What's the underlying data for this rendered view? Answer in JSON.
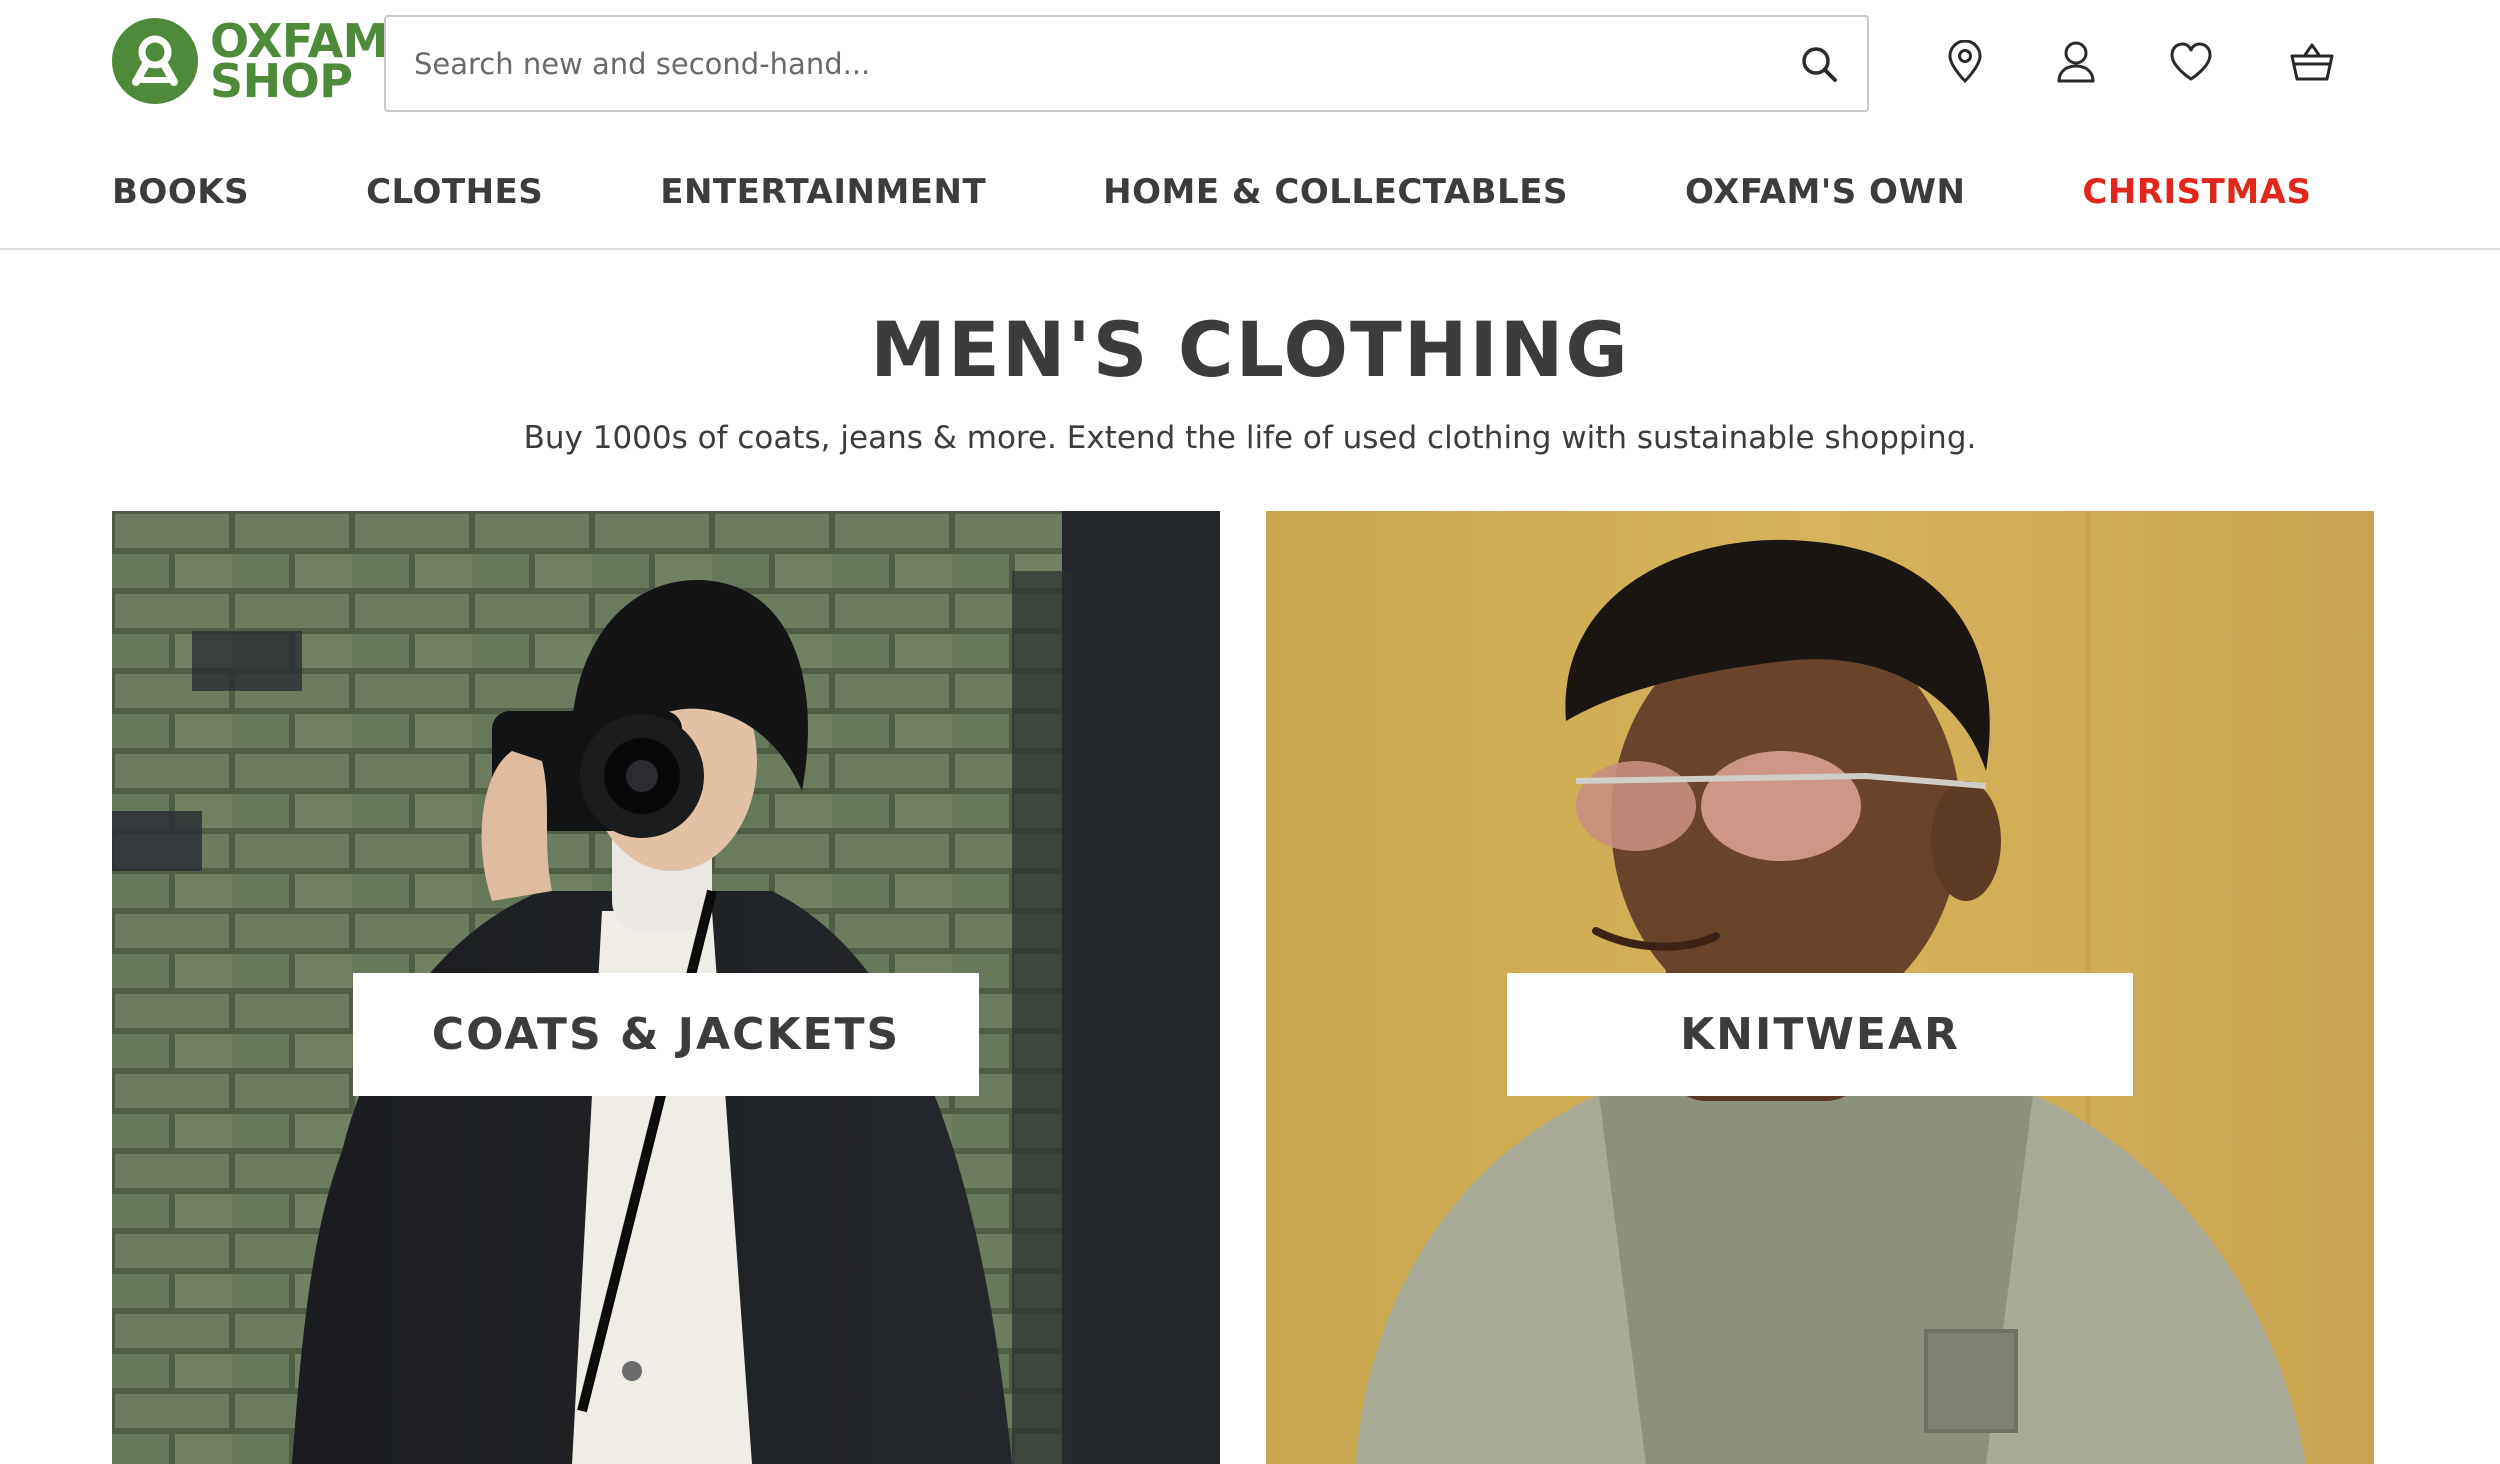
{
  "header": {
    "logo_line1": "OXFAM",
    "logo_line2": "SHOP",
    "search_placeholder": "Search new and second-hand...",
    "icons": [
      "search-icon",
      "location-pin-icon",
      "account-icon",
      "heart-icon",
      "basket-icon"
    ]
  },
  "nav": {
    "items": [
      {
        "label": "BOOKS"
      },
      {
        "label": "CLOTHES"
      },
      {
        "label": "ENTERTAINMENT"
      },
      {
        "label": "HOME & COLLECTABLES"
      },
      {
        "label": "OXFAM'S OWN"
      },
      {
        "label": "CHRISTMAS",
        "highlight": true
      }
    ]
  },
  "main": {
    "title": "MEN'S CLOTHING",
    "subtitle": "Buy 1000s of coats, jeans & more. Extend the life of used clothing with sustainable shopping.",
    "categories": [
      {
        "label": "COATS & JACKETS"
      },
      {
        "label": "KNITWEAR"
      }
    ]
  },
  "colors": {
    "brand_green": "#4e8a3a",
    "christmas_red": "#e3261b",
    "text": "#3c3c3c"
  }
}
